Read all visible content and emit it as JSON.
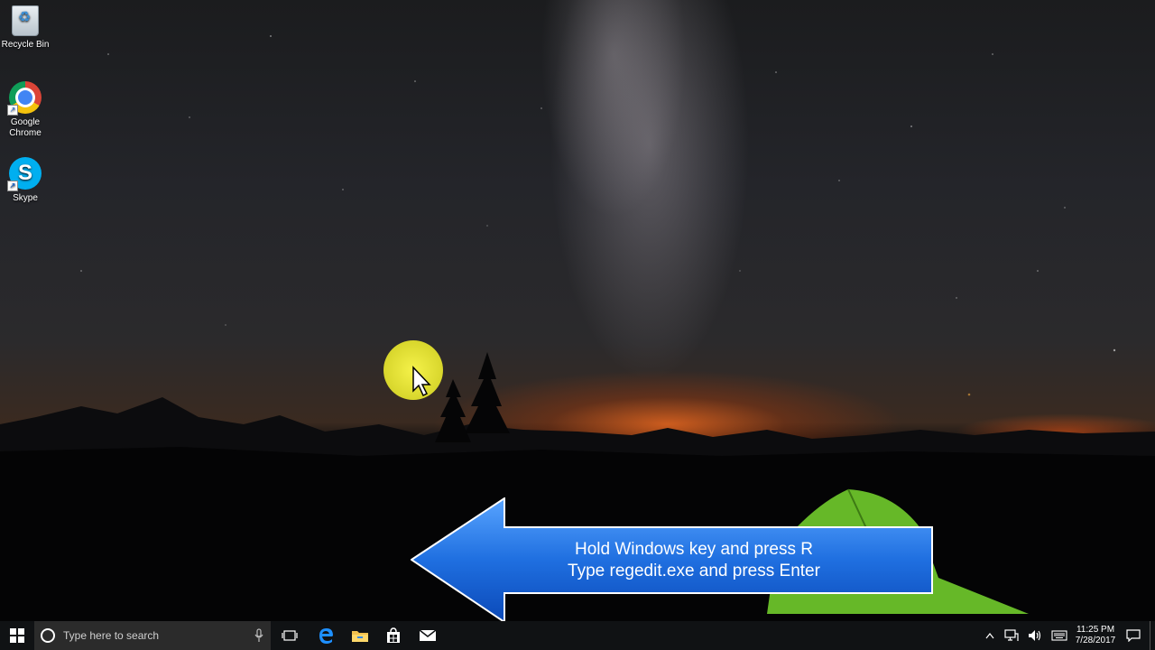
{
  "desktop": {
    "icons": [
      {
        "label": "Recycle Bin",
        "icon": "recycle-bin-icon"
      },
      {
        "label": "Google Chrome",
        "icon": "chrome-icon"
      },
      {
        "label": "Skype",
        "icon": "skype-icon"
      }
    ]
  },
  "callout": {
    "line1": "Hold Windows key and press R",
    "line2": "Type regedit.exe and press Enter",
    "color": "#1f6fe0"
  },
  "taskbar": {
    "search_placeholder": "Type here to search",
    "pinned": [
      "task-view-icon",
      "edge-icon",
      "file-explorer-icon",
      "store-icon",
      "mail-icon"
    ],
    "clock_time": "11:25 PM",
    "clock_date": "7/28/2017",
    "accent": "#0078d7"
  }
}
